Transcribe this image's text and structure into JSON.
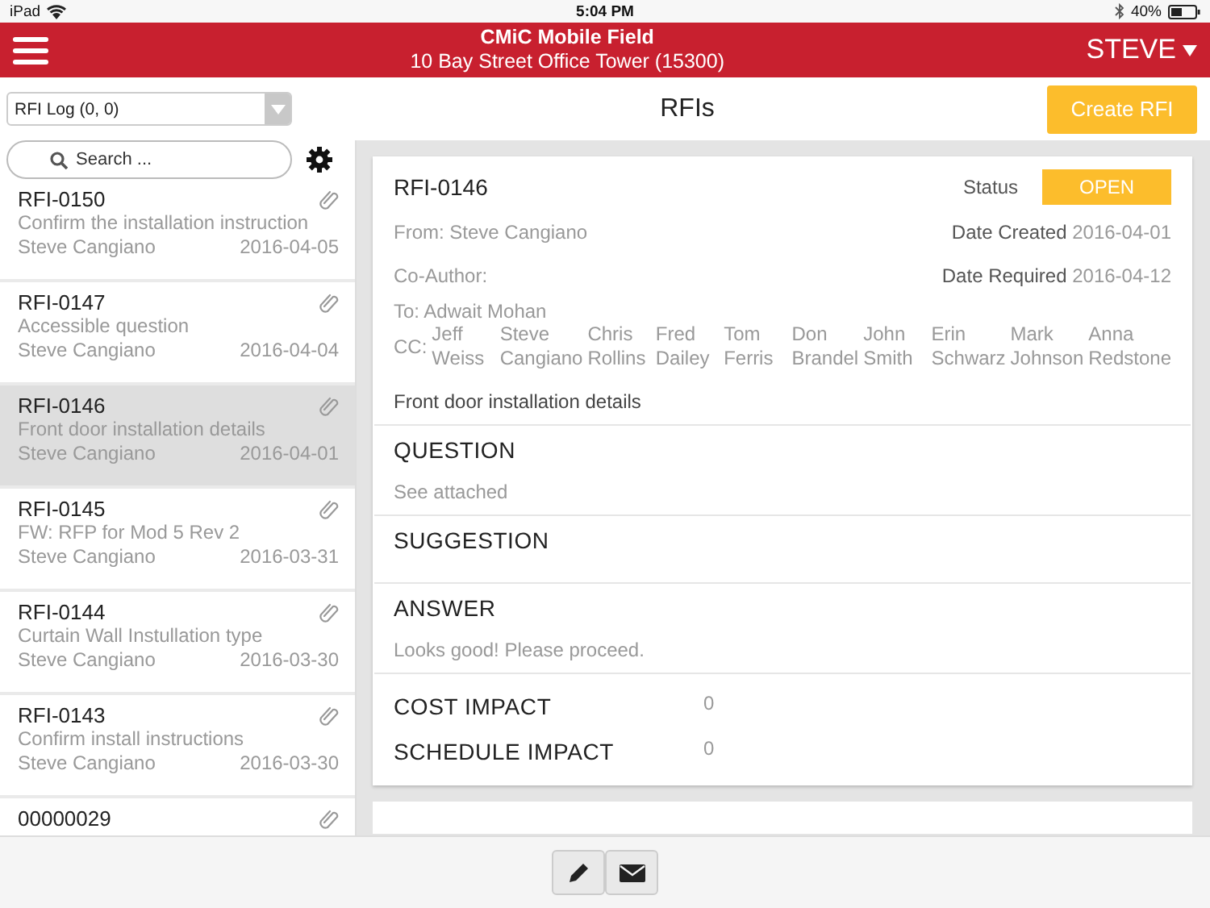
{
  "status_bar": {
    "carrier": "iPad",
    "time": "5:04 PM",
    "battery": "40%"
  },
  "header": {
    "title": "CMiC Mobile Field",
    "subtitle": "10 Bay Street Office Tower (15300)",
    "user": "STEVE"
  },
  "toolbar": {
    "log_select": "RFI Log (0, 0)",
    "page_title": "RFIs",
    "create_button": "Create RFI"
  },
  "search": {
    "placeholder": "Search ..."
  },
  "rfi_list": [
    {
      "number": "RFI-0150",
      "subject": "Confirm the installation instruction",
      "author": "Steve Cangiano",
      "date": "2016-04-05",
      "attachment": true,
      "selected": false
    },
    {
      "number": "RFI-0147",
      "subject": "Accessible question",
      "author": "Steve Cangiano",
      "date": "2016-04-04",
      "attachment": true,
      "selected": false
    },
    {
      "number": "RFI-0146",
      "subject": "Front door installation details",
      "author": "Steve Cangiano",
      "date": "2016-04-01",
      "attachment": true,
      "selected": true
    },
    {
      "number": "RFI-0145",
      "subject": "FW: RFP for Mod 5 Rev 2",
      "author": "Steve Cangiano",
      "date": "2016-03-31",
      "attachment": true,
      "selected": false
    },
    {
      "number": "RFI-0144",
      "subject": "Curtain Wall Instullation type",
      "author": "Steve Cangiano",
      "date": "2016-03-30",
      "attachment": true,
      "selected": false
    },
    {
      "number": "RFI-0143",
      "subject": "Confirm install instructions",
      "author": "Steve Cangiano",
      "date": "2016-03-30",
      "attachment": true,
      "selected": false
    },
    {
      "number": "00000029",
      "attachment": true,
      "selected": false
    }
  ],
  "detail": {
    "number": "RFI-0146",
    "status_label": "Status",
    "status": "OPEN",
    "from": "From: Steve Cangiano",
    "date_created_label": "Date Created",
    "date_created": "2016-04-01",
    "co_author": "Co-Author:",
    "date_required_label": "Date Required",
    "date_required": "2016-04-12",
    "to": "To: Adwait Mohan",
    "cc_label": "CC:",
    "cc": [
      "Jeff Weiss",
      "Steve Cangiano",
      "Chris Rollins",
      "Fred Dailey",
      "Tom Ferris",
      "Don Brandel",
      "John Smith",
      "Erin Schwarz",
      "Mark Johnson",
      "Anna Redstone"
    ],
    "description": "Front door installation details",
    "sections": [
      {
        "title": "QUESTION",
        "body": "See attached"
      },
      {
        "title": "SUGGESTION"
      },
      {
        "title": "ANSWER",
        "body": "Looks good! Please proceed."
      }
    ],
    "impacts": [
      {
        "label": "COST IMPACT",
        "value": "0"
      },
      {
        "label": "SCHEDULE IMPACT",
        "value": "0"
      }
    ]
  }
}
